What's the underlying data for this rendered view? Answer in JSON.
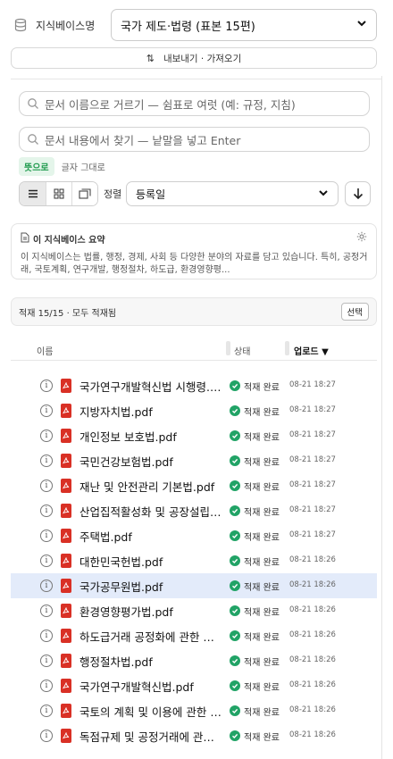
{
  "kb": {
    "label": "지식베이스명",
    "selected": "국가 제도·법령 (표본 15편)"
  },
  "io_button": "내보내기 · 가져오기",
  "search_title": {
    "placeholder": "문서 이름으로 거르기 — 쉼표로 여럿 (예: 규정, 지침)"
  },
  "search_content": {
    "placeholder": "문서 내용에서 찾기 — 낱말을 넣고 Enter"
  },
  "search_mode": {
    "active": "뜻으로",
    "other": "글자 그대로"
  },
  "sort": {
    "label": "정렬",
    "selected": "등록일"
  },
  "summary": {
    "title": "이 지식베이스 요약",
    "text": "이 지식베이스는 법률, 행정, 경제, 사회 등 다양한 분야의 자료를 담고 있습니다. 특히, 공정거래, 국토계획, 연구개발, 행정절차, 하도급, 환경영향평..."
  },
  "load_status": {
    "text": "적재 15/15 · 모두 적재됨",
    "select_button": "선택"
  },
  "table": {
    "col_name": "이름",
    "col_status": "상태",
    "col_upload": "업로드 ▼"
  },
  "files": [
    {
      "name": "국가연구개발혁신법 시행령.pdf",
      "status": "적재 완료",
      "date": "08-21 18:27"
    },
    {
      "name": "지방자치법.pdf",
      "status": "적재 완료",
      "date": "08-21 18:27"
    },
    {
      "name": "개인정보 보호법.pdf",
      "status": "적재 완료",
      "date": "08-21 18:27"
    },
    {
      "name": "국민건강보험법.pdf",
      "status": "적재 완료",
      "date": "08-21 18:27"
    },
    {
      "name": "재난 및 안전관리 기본법.pdf",
      "status": "적재 완료",
      "date": "08-21 18:27"
    },
    {
      "name": "산업집적활성화 및 공장설립에 관한 법률.pdf",
      "status": "적재 완료",
      "date": "08-21 18:27"
    },
    {
      "name": "주택법.pdf",
      "status": "적재 완료",
      "date": "08-21 18:27"
    },
    {
      "name": "대한민국헌법.pdf",
      "status": "적재 완료",
      "date": "08-21 18:26"
    },
    {
      "name": "국가공무원법.pdf",
      "status": "적재 완료",
      "date": "08-21 18:26"
    },
    {
      "name": "환경영향평가법.pdf",
      "status": "적재 완료",
      "date": "08-21 18:26"
    },
    {
      "name": "하도급거래 공정화에 관한 법률.pdf",
      "status": "적재 완료",
      "date": "08-21 18:26"
    },
    {
      "name": "행정절차법.pdf",
      "status": "적재 완료",
      "date": "08-21 18:26"
    },
    {
      "name": "국가연구개발혁신법.pdf",
      "status": "적재 완료",
      "date": "08-21 18:26"
    },
    {
      "name": "국토의 계획 및 이용에 관한 법률.pdf",
      "status": "적재 완료",
      "date": "08-21 18:26"
    },
    {
      "name": "독점규제 및 공정거래에 관한 법률.pdf",
      "status": "적재 완료",
      "date": "08-21 18:26"
    }
  ],
  "selected_index": 8,
  "colors": {
    "pdf": "#d93025",
    "status_ok": "#21a366",
    "selected_row": "#e3ebfa"
  }
}
